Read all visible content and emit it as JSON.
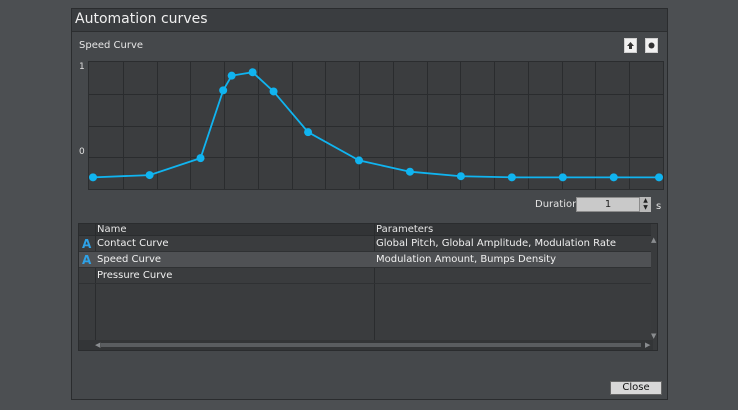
{
  "dialog": {
    "title": "Automation curves"
  },
  "curve": {
    "label": "Speed Curve",
    "y_ticks": [
      "1",
      "0"
    ],
    "line_color": "#10b4f0",
    "points": [
      [
        0.0,
        0.05
      ],
      [
        0.1,
        0.07
      ],
      [
        0.19,
        0.22
      ],
      [
        0.23,
        0.82
      ],
      [
        0.245,
        0.95
      ],
      [
        0.282,
        0.98
      ],
      [
        0.319,
        0.81
      ],
      [
        0.38,
        0.45
      ],
      [
        0.47,
        0.2
      ],
      [
        0.56,
        0.1
      ],
      [
        0.65,
        0.06
      ],
      [
        0.74,
        0.05
      ],
      [
        0.83,
        0.05
      ],
      [
        0.92,
        0.05
      ],
      [
        1.0,
        0.05
      ]
    ],
    "icons": [
      "upload-icon",
      "record-icon"
    ]
  },
  "duration": {
    "label": "Duration",
    "value": "1",
    "unit": "s"
  },
  "table": {
    "headers": {
      "name": "Name",
      "parameters": "Parameters"
    },
    "rows": [
      {
        "badge": "A",
        "name": "Contact Curve",
        "parameters": "Global Pitch, Global Amplitude, Modulation Rate"
      },
      {
        "badge": "A",
        "name": "Speed Curve",
        "parameters": "Modulation Amount, Bumps Density"
      },
      {
        "badge": "",
        "name": "Pressure Curve",
        "parameters": ""
      }
    ]
  },
  "buttons": {
    "close": "Close"
  }
}
